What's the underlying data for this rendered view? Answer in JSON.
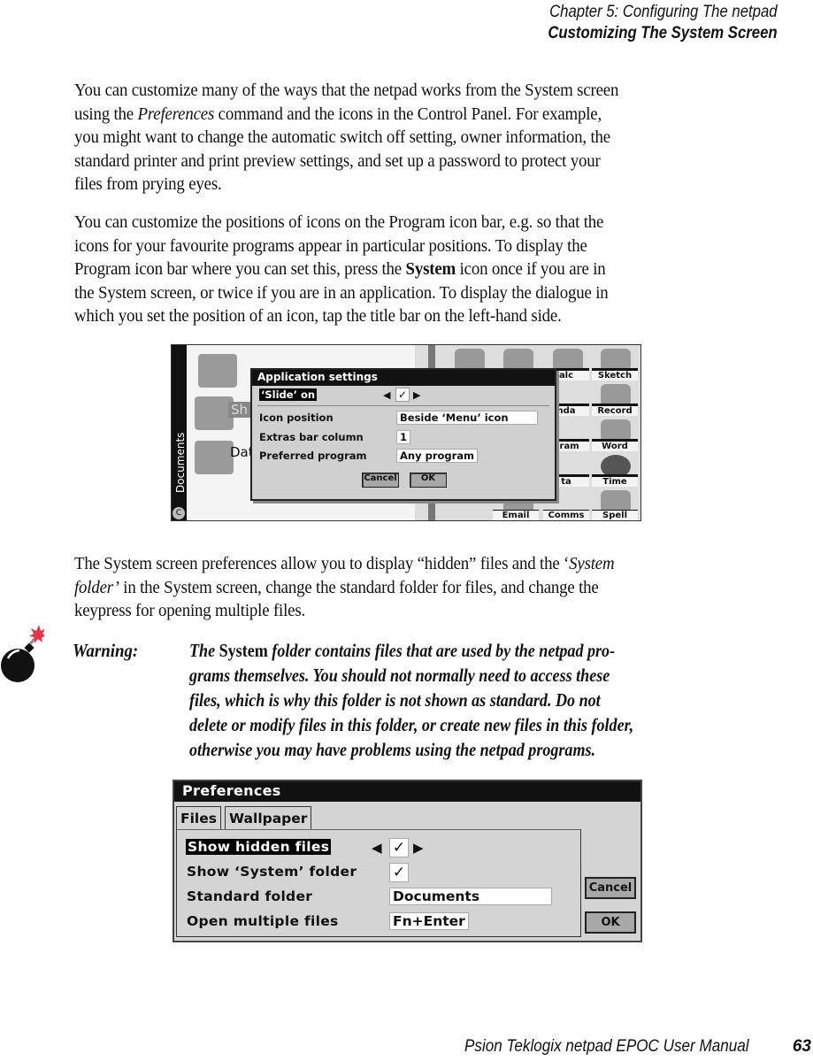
{
  "header": {
    "chapter": "Chapter 5:  Configuring The netpad",
    "section": "Customizing The System Screen"
  },
  "paragraphs": {
    "p1": {
      "l1": "You can customize many of the ways that the netpad works from the System screen",
      "l2a": "using the ",
      "l2b": "Preferences",
      "l2c": " command and the icons in the Control Panel. For example,",
      "l3": "you might want to change the automatic switch off setting, owner information, the",
      "l4": "standard printer and print preview settings, and set up a password to protect your",
      "l5": "files from prying eyes."
    },
    "p2": {
      "l1": "You can customize the positions of icons on the Program icon bar, e.g. so that the",
      "l2": "icons for your favourite programs appear in particular positions. To display the",
      "l3a": "Program icon bar where you can set this, press the ",
      "l3b": "System",
      "l3c": " icon once if you are in",
      "l4": "the System screen, or twice if you are in an application. To display the dialogue in",
      "l5": "which you set the position of an icon, tap the title bar on the left-hand side."
    },
    "p3": {
      "l1a": "The System screen preferences allow you to display “hidden” files and the ‘",
      "l1b": "System",
      "l2a": "folder’",
      "l2b": " in the System screen, change the standard folder for files, and change the",
      "l3": "keypress for opening multiple files."
    }
  },
  "warning": {
    "icon": "bomb-icon",
    "label": "Warning:",
    "l1a": "The ",
    "l1b": "System",
    "l1c": " folder contains files that are used by the netpad pro-",
    "l2": "grams themselves. You should not normally need to access these",
    "l3": "files, which is why this folder is not shown as standard. Do not",
    "l4": "delete or modify files in this folder, or create new files in this folder,",
    "l5": "otherwise you may have problems using the netpad programs."
  },
  "screenshot1": {
    "sidebar_label": "Documents",
    "sidebar_button": "C",
    "files": [
      "Sh",
      "Dat"
    ],
    "grid_labels": [
      "alc",
      "Sketch",
      "nda",
      "Record",
      "gram",
      "Word",
      "ta",
      "Time",
      "Email",
      "Comms",
      "Spell"
    ],
    "dialog": {
      "title": "Application settings",
      "rows": [
        {
          "label": "‘Slide’ on",
          "value": "✓"
        },
        {
          "label": "Icon position",
          "value": "Beside ‘Menu’ icon"
        },
        {
          "label": "Extras bar column",
          "value": "1"
        },
        {
          "label": "Preferred program",
          "value": "Any program"
        }
      ],
      "cancel": "Cancel",
      "ok": "OK"
    }
  },
  "screenshot2": {
    "title": "Preferences",
    "tabs": [
      "Files",
      "Wallpaper"
    ],
    "rows": [
      {
        "label": "Show hidden files",
        "value": "✓"
      },
      {
        "label": "Show ‘System’ folder",
        "value": "✓"
      },
      {
        "label": "Standard folder",
        "value": "Documents"
      },
      {
        "label": "Open multiple files",
        "value": "Fn+Enter"
      }
    ],
    "cancel": "Cancel",
    "ok": "OK"
  },
  "footer": {
    "title": "Psion Teklogix netpad EPOC User Manual",
    "page": "63"
  }
}
